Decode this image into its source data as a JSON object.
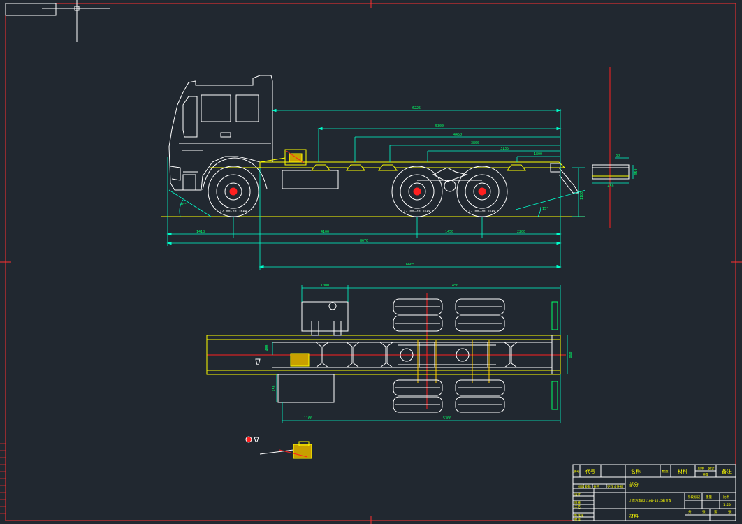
{
  "colors": {
    "background": "#212830",
    "frame": "#ff3030",
    "outline": "#ffffff",
    "dimension": "#00ffcc",
    "dimension_text": "#00ff66",
    "chassis": "#ffff00",
    "centerline": "#ff2020",
    "accent": "#ffcc00"
  },
  "side_view": {
    "dimensions": {
      "overall_bed": "6225",
      "d2": "5300",
      "d3": "4450",
      "d4": "3800",
      "d5": "3135",
      "d6": "1800",
      "front_overhang": "1418",
      "wheelbase_1": "4100",
      "axle_spacing": "1450",
      "rear_overhang": "2200",
      "total_length": "8670",
      "bed_length": "6605",
      "height": "1180",
      "approach_angle": "20°",
      "departure_angle": "15°"
    },
    "tyre_labels": [
      "12.00-20 16PR",
      "12.00-20 16PR",
      "12.00-20 16PR"
    ],
    "detail": {
      "width": "450",
      "height": "950",
      "offset": "80"
    }
  },
  "top_view": {
    "dimensions": {
      "tank_width": "1000",
      "bed_to_axle": "1450",
      "left_offset": "1160",
      "total": "5300",
      "frame_width": "860",
      "offset_a": "400",
      "offset_b": "550"
    }
  },
  "title_block": {
    "header": [
      "序号",
      "代号",
      "名称",
      "数量",
      "材料",
      "单件",
      "总计",
      "备注"
    ],
    "weight_label": "重量",
    "part_label": "部分",
    "rows": [
      "标记",
      "处数",
      "分区",
      "更改文件号",
      "签名",
      "年月日"
    ],
    "left_labels": [
      "设计",
      "审核",
      "工艺",
      "标准化",
      "批准"
    ],
    "drawing_name": "北京汽车BJ1160-16.5载货车",
    "stage_labels": [
      "阶段标记",
      "重量",
      "比例"
    ],
    "scale": "1:20",
    "sheet_labels": [
      "共",
      "张",
      "第",
      "张"
    ],
    "material": "材料"
  }
}
